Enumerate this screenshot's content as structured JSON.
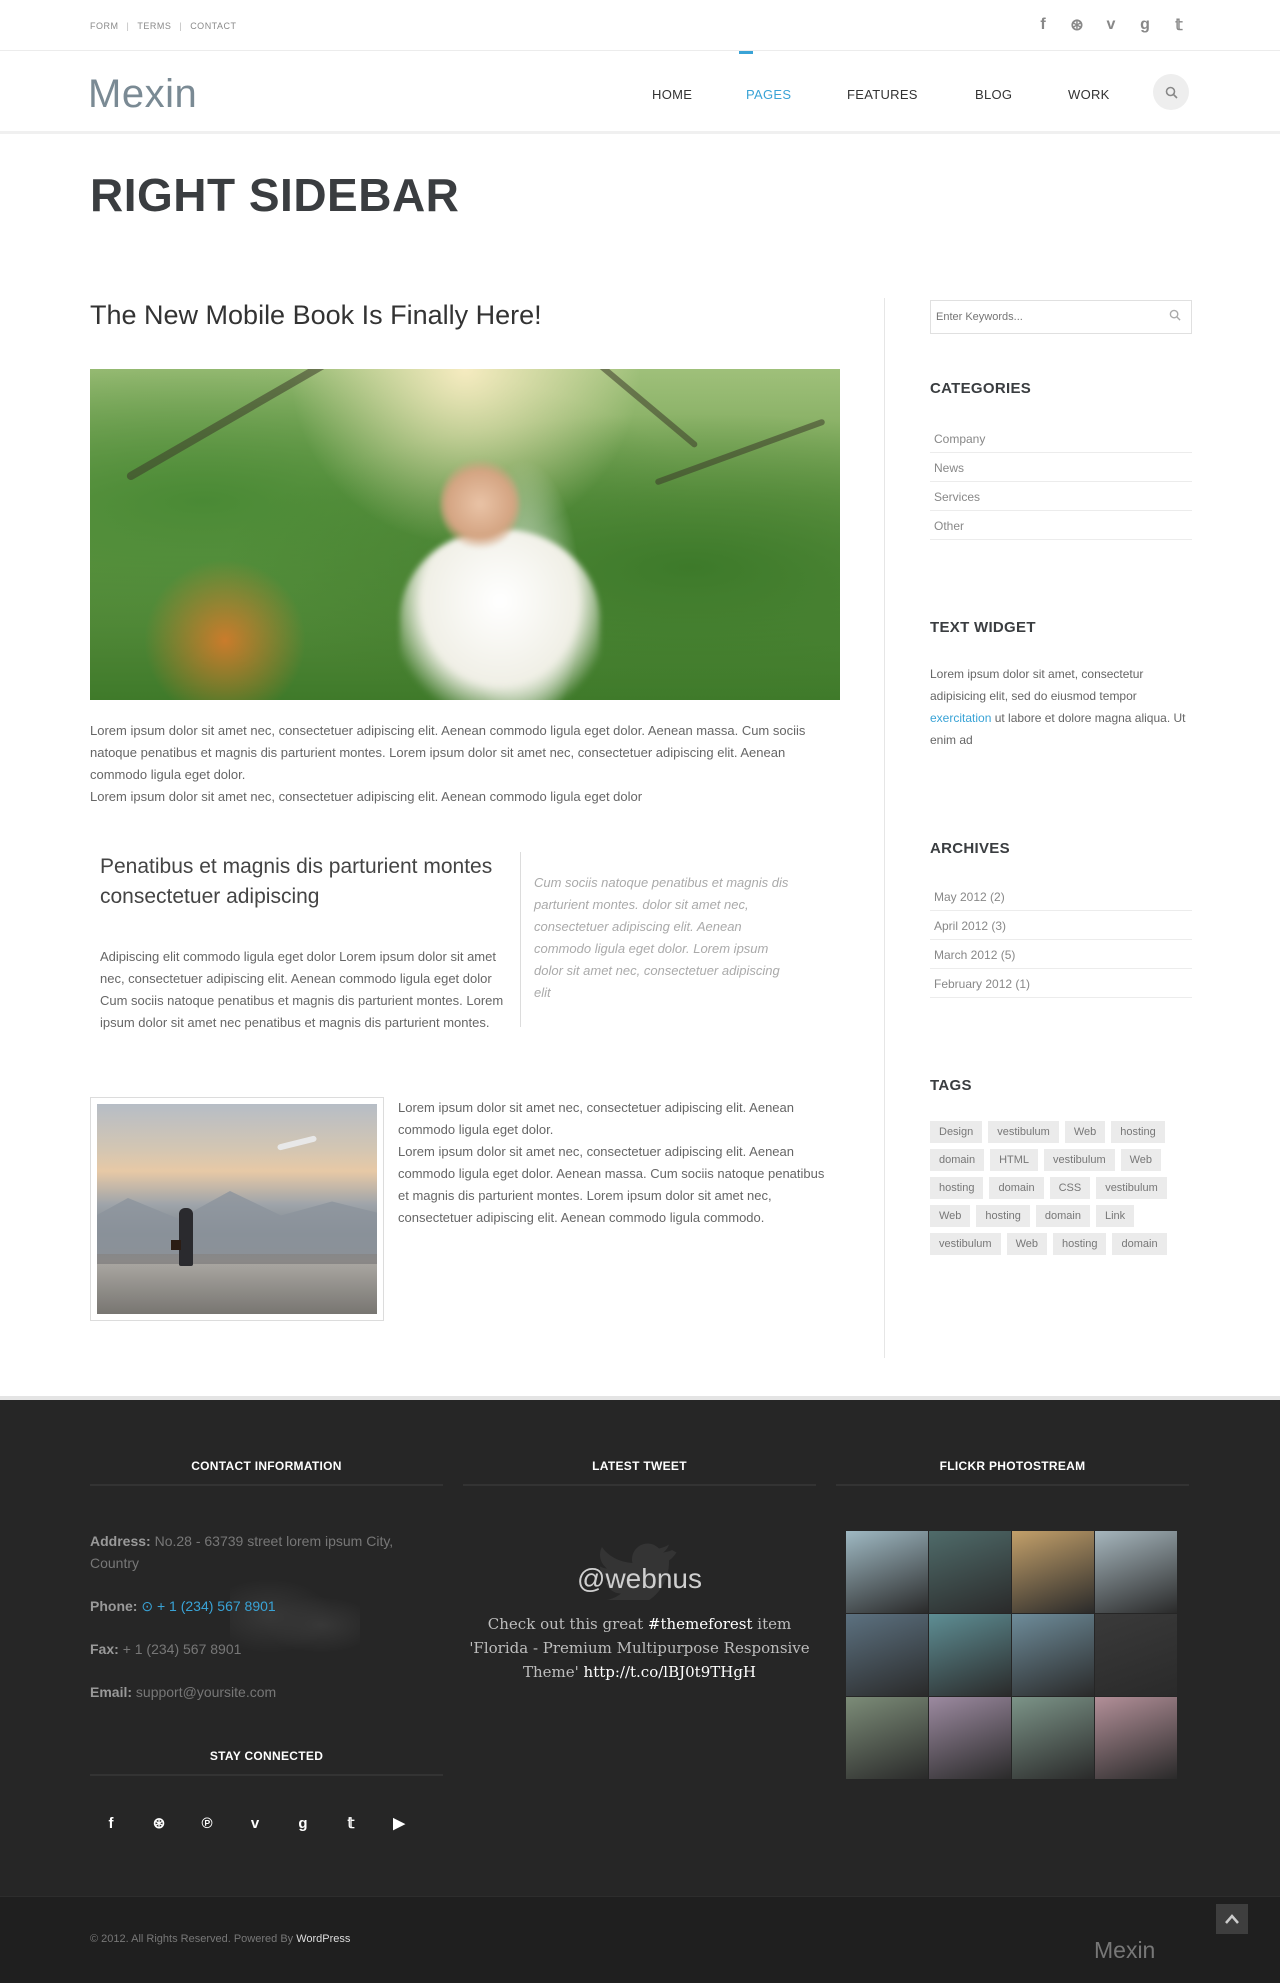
{
  "topbar": {
    "links": [
      "FORM",
      "TERMS",
      "CONTACT"
    ],
    "social_icons": [
      "facebook-icon",
      "dribbble-icon",
      "vimeo-icon",
      "googleplus-icon",
      "twitter-icon"
    ],
    "social_glyphs": [
      "f",
      "⊛",
      "v",
      "g",
      "𝕥"
    ]
  },
  "header": {
    "logo": "Mexin",
    "nav": [
      {
        "label": "HOME",
        "active": false
      },
      {
        "label": "PAGES",
        "active": true
      },
      {
        "label": "FEATURES",
        "active": false
      },
      {
        "label": "BLOG",
        "active": false
      },
      {
        "label": "WORK",
        "active": false
      }
    ]
  },
  "page": {
    "title": "RIGHT SIDEBAR"
  },
  "post": {
    "title": "The New Mobile Book Is Finally Here!",
    "paragraph1": "Lorem ipsum dolor sit amet nec, consectetuer adipiscing elit. Aenean commodo ligula eget dolor. Aenean massa. Cum sociis natoque penatibus et magnis dis parturient montes. Lorem ipsum dolor sit amet nec, consectetuer adipiscing elit. Aenean commodo ligula eget dolor.",
    "paragraph1b": "Lorem ipsum dolor sit amet nec, consectetuer adipiscing elit. Aenean commodo ligula eget dolor",
    "subtitle": "Penatibus et magnis dis parturient montes consectetuer adipiscing",
    "paragraph2": "Adipiscing elit commodo ligula eget dolor Lorem ipsum dolor sit amet nec, consectetuer adipiscing elit. Aenean commodo ligula eget dolor Cum sociis natoque penatibus et magnis dis parturient montes. Lorem ipsum dolor sit amet nec penatibus et magnis dis parturient montes.",
    "quote": "Cum sociis natoque penatibus et magnis dis parturient montes. dolor sit amet nec, consectetuer adipiscing elit. Aenean commodo ligula eget dolor. Lorem ipsum dolor sit amet nec, consectetuer adipiscing elit",
    "paragraph3": "Lorem ipsum dolor sit amet nec, consectetuer adipiscing elit. Aenean commodo ligula eget dolor.",
    "paragraph3b": "Lorem ipsum dolor sit amet nec, consectetuer adipiscing elit. Aenean commodo ligula eget dolor. Aenean massa. Cum sociis natoque penatibus et magnis dis parturient montes. Lorem ipsum dolor sit amet nec, consectetuer adipiscing elit. Aenean commodo ligula commodo."
  },
  "sidebar": {
    "search_placeholder": "Enter Keywords...",
    "categories_title": "CATEGORIES",
    "categories": [
      "Company",
      "News",
      "Services",
      "Other"
    ],
    "text_widget_title": "TEXT WIDGET",
    "text_widget_before": "Lorem ipsum dolor sit amet, consectetur adipisicing elit, sed do eiusmod tempor ",
    "text_widget_link": "exercitation",
    "text_widget_after": " ut labore et dolore magna aliqua. Ut enim ad",
    "archives_title": "ARCHIVES",
    "archives": [
      "May 2012 (2)",
      "April 2012 (3)",
      "March 2012 (5)",
      "February 2012 (1)"
    ],
    "tags_title": "TAGS",
    "tags": [
      "Design",
      "vestibulum",
      "Web",
      "hosting",
      "domain",
      "HTML",
      "vestibulum",
      "Web",
      "hosting",
      "domain",
      "CSS",
      "vestibulum",
      "Web",
      "hosting",
      "domain",
      "Link",
      "vestibulum",
      "Web",
      "hosting",
      "domain"
    ]
  },
  "footer": {
    "contact_title": "CONTACT INFORMATION",
    "address_label": "Address:",
    "address": "No.28 - 63739 street lorem ipsum City, Country",
    "phone_label": "Phone:",
    "phone": "+ 1 (234) 567 8901",
    "fax_label": "Fax:",
    "fax": "+ 1 (234) 567 8901",
    "email_label": "Email:",
    "email": "support@yoursite.com",
    "stay_title": "STAY CONNECTED",
    "stay_icons": [
      "facebook-icon",
      "dribbble-icon",
      "pinterest-icon",
      "vimeo-icon",
      "googleplus-icon",
      "twitter-icon",
      "youtube-icon"
    ],
    "stay_glyphs": [
      "f",
      "⊛",
      "℗",
      "v",
      "g",
      "𝕥",
      "▶"
    ],
    "tweet_title": "LATEST TWEET",
    "tweet_handle": "@webnus",
    "tweet_line1": "Check out this great ",
    "tweet_hash": "#themeforest",
    "tweet_line1b": " item 'Florida - Premium Multipurpose Responsive Theme' ",
    "tweet_link": "http://t.co/lBJ0t9THgH",
    "flickr_title": "FLICKR PHOTOSTREAM",
    "flickr_colors": [
      "#9fb9c3",
      "#4f6b6a",
      "#c3a06a",
      "#a6b6bd",
      "#5c7180",
      "#5e8e94",
      "#6e8c9a",
      "#3a3a3a",
      "#7c8c78",
      "#9c8aa0",
      "#7c9488",
      "#b28f98"
    ],
    "copyright_before": "© 2012. All Rights Reserved. Powered By ",
    "copyright_link": "WordPress",
    "logo": "Mexin"
  }
}
